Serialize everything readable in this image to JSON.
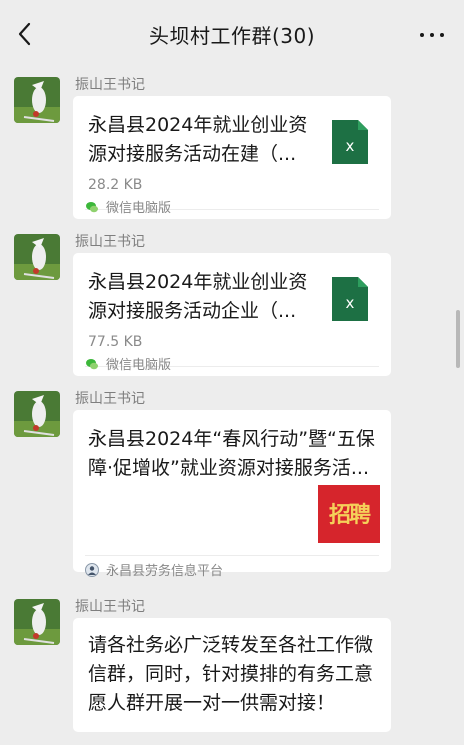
{
  "header": {
    "title": "头坝村工作群(30)"
  },
  "messages": [
    {
      "sender": "振山王书记",
      "type": "file",
      "file_title": "永昌县2024年就业创业资源对接服务活动在建（...",
      "file_title_line1": "永昌县2024年就业创业资",
      "file_title_line2": "源对接服务活动在建（...",
      "file_size": "28.2 KB",
      "source": "微信电脑版",
      "file_icon": "excel-icon"
    },
    {
      "sender": "振山王书记",
      "type": "file",
      "file_title": "永昌县2024年就业创业资源对接服务活动企业（...",
      "file_title_line1": "永昌县2024年就业创业资",
      "file_title_line2": "源对接服务活动企业（...",
      "file_size": "77.5 KB",
      "source": "微信电脑版",
      "file_icon": "excel-icon"
    },
    {
      "sender": "振山王书记",
      "type": "article",
      "title_line1": "永昌县2024年“春风行动”暨“五保",
      "title_line2": "障·促增收”就业资源对接服务活...",
      "thumbnail_text": "招聘",
      "source": "永昌县劳务信息平台"
    },
    {
      "sender": "振山王书记",
      "type": "text",
      "line1": "请各社务必广泛转发至各社工作微",
      "line2": "信群，同时，针对摸排的有务工意",
      "line3": "愿人群开展一对一供需对接！"
    }
  ],
  "colors": {
    "excel": "#1d7044",
    "excel_light": "#2e9e5e",
    "thumbnail_bg": "#d6252c",
    "thumbnail_text": "#f5d05a"
  },
  "icons": {
    "back": "chevron-left-icon",
    "more": "more-dots-icon"
  }
}
